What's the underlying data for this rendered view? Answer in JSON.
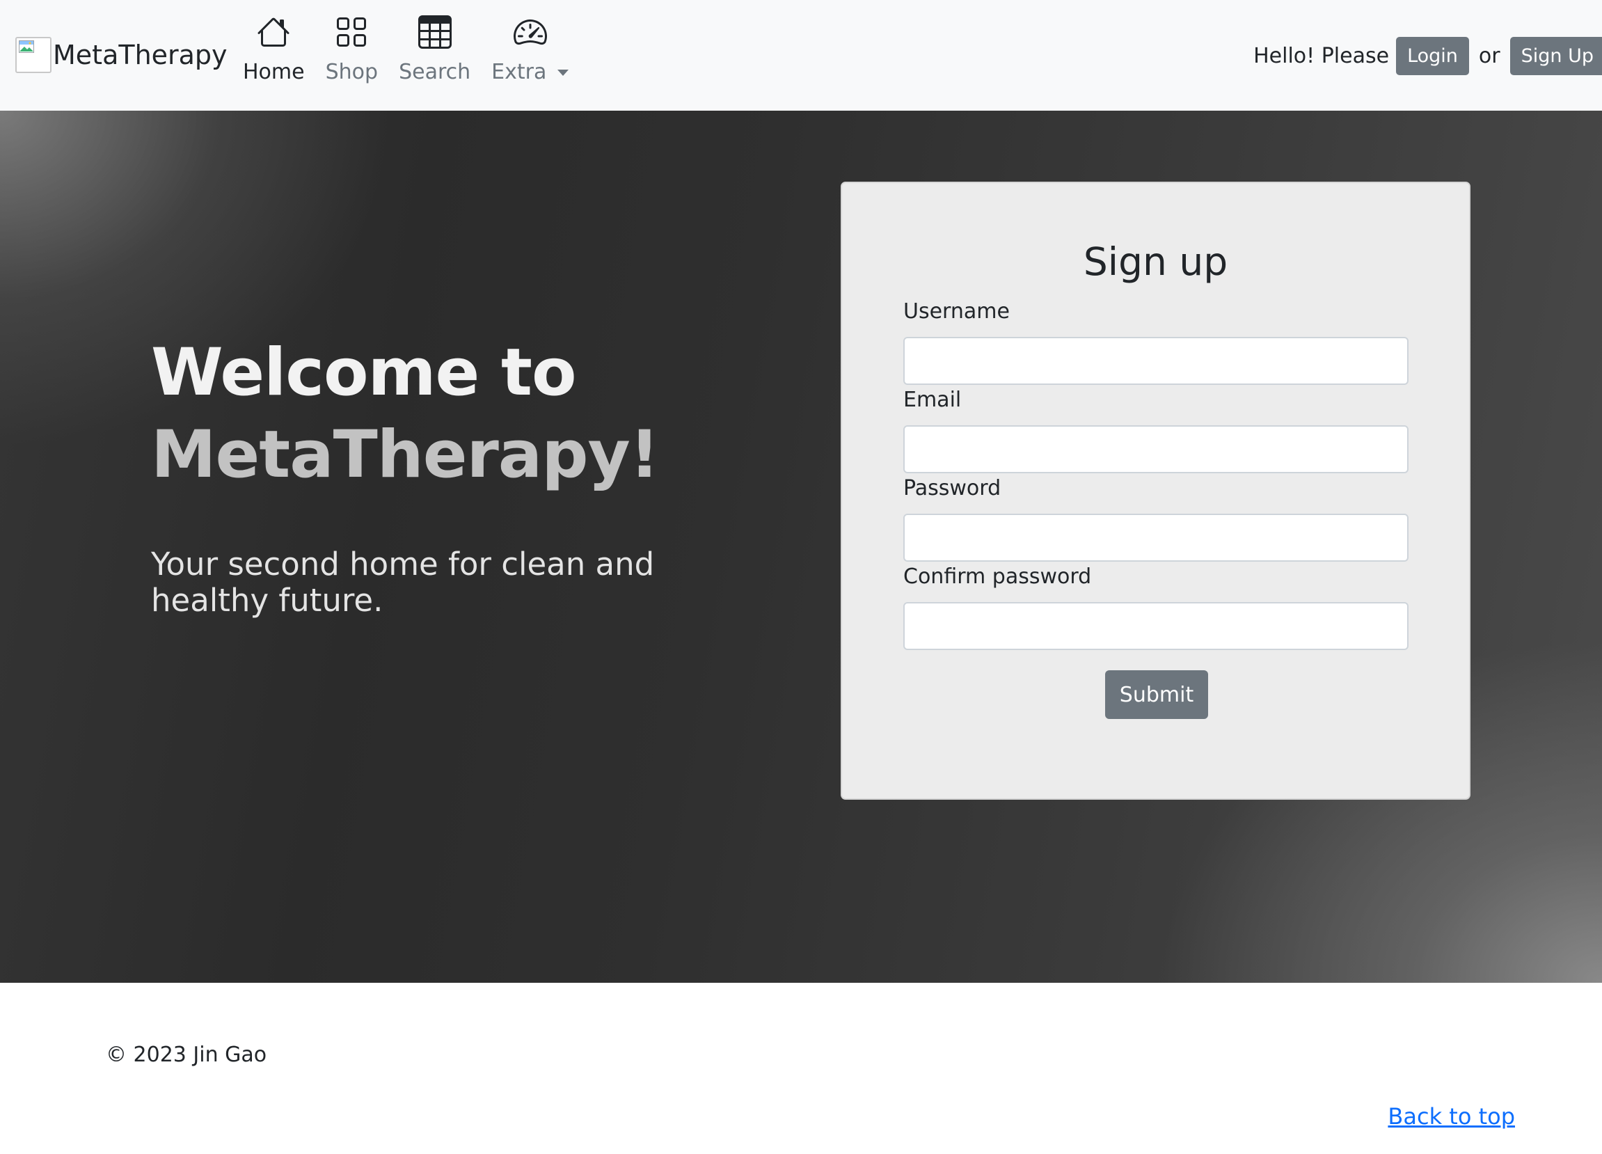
{
  "navbar": {
    "brand": "MetaTherapy",
    "items": [
      {
        "label": "Home",
        "icon": "house-icon",
        "active": true
      },
      {
        "label": "Shop",
        "icon": "grid-icon",
        "active": false
      },
      {
        "label": "Search",
        "icon": "table-icon",
        "active": false
      },
      {
        "label": "Extra",
        "icon": "speedometer-icon",
        "active": false,
        "dropdown": true
      }
    ],
    "auth": {
      "greeting": "Hello! Please",
      "login_label": "Login",
      "or_text": "or",
      "signup_label": "Sign Up"
    }
  },
  "hero": {
    "title_line1": "Welcome to",
    "title_line2": "MetaTherapy!",
    "subtitle": "Your second home for clean and healthy future."
  },
  "signup_form": {
    "title": "Sign up",
    "fields": [
      {
        "label": "Username",
        "value": ""
      },
      {
        "label": "Email",
        "value": ""
      },
      {
        "label": "Password",
        "value": ""
      },
      {
        "label": "Confirm password",
        "value": ""
      }
    ],
    "submit_label": "Submit"
  },
  "footer": {
    "copyright": "© 2023 Jin Gao",
    "back_to_top": "Back to top"
  },
  "colors": {
    "navbar_bg": "#f8f9fa",
    "button_secondary": "#6c757d",
    "link": "#0d6efd",
    "form_bg": "#ececec"
  }
}
